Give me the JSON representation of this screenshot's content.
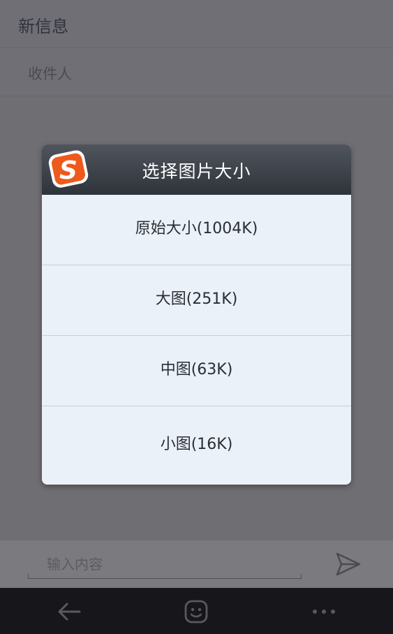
{
  "header": {
    "title": "新信息"
  },
  "recipient": {
    "label": "收件人"
  },
  "dialog": {
    "title": "选择图片大小",
    "logo_text": "S",
    "options": [
      {
        "label": "原始大小(1004K)"
      },
      {
        "label": "大图(251K)"
      },
      {
        "label": "中图(63K)"
      },
      {
        "label": "小图(16K)"
      }
    ]
  },
  "composer": {
    "placeholder": "输入内容",
    "send_icon": "send-icon"
  },
  "navbar": {
    "icons": [
      "back-icon",
      "emoji-icon",
      "more-icon"
    ]
  },
  "colors": {
    "header_bg": "#3f444b",
    "dialog_bg": "#eaf1f8",
    "logo_orange": "#ee5a1c",
    "navbar_bg": "#17161b"
  }
}
